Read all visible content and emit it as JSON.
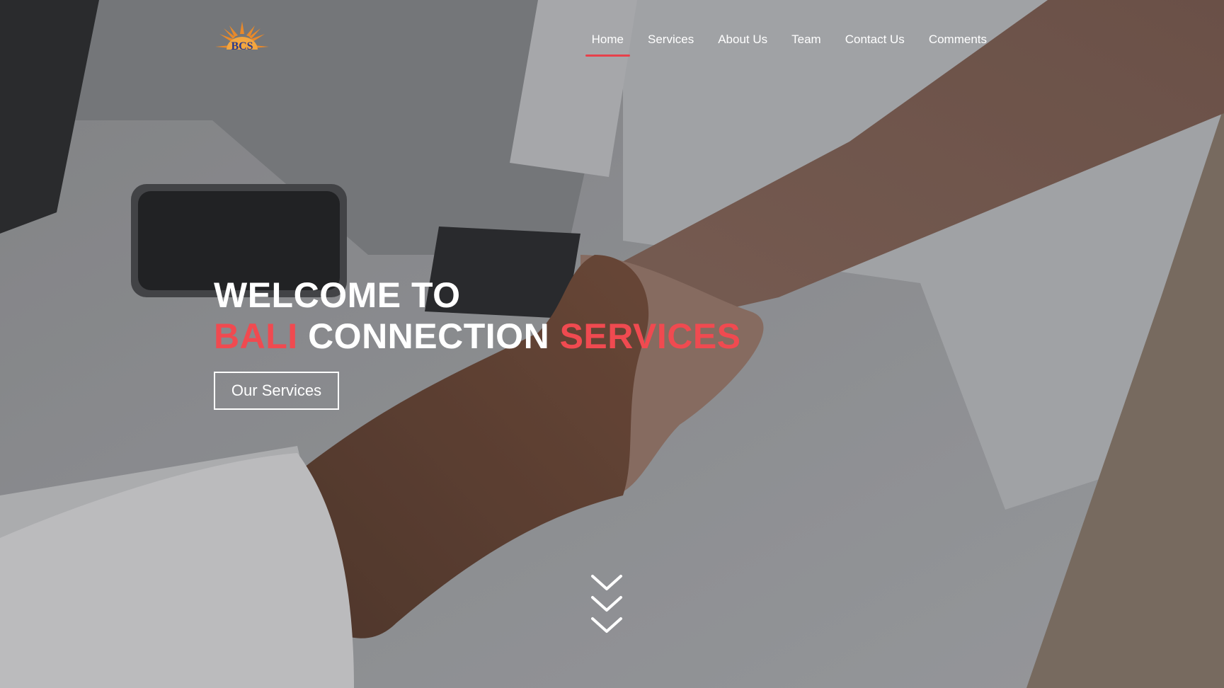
{
  "logo": {
    "text": "BCS"
  },
  "nav": {
    "items": [
      {
        "label": "Home",
        "active": true
      },
      {
        "label": "Services",
        "active": false
      },
      {
        "label": "About Us",
        "active": false
      },
      {
        "label": "Team",
        "active": false
      },
      {
        "label": "Contact Us",
        "active": false
      },
      {
        "label": "Comments",
        "active": false
      }
    ]
  },
  "hero": {
    "line1": "WELCOME TO",
    "line2_part1": "BALI",
    "line2_part2": "CONNECTION",
    "line2_part3": "SERVICES",
    "cta_label": "Our Services"
  },
  "icons": {
    "scroll": "chevrons-down-icon"
  },
  "colors": {
    "accent": "#f04a50",
    "nav_underline": "#e8414b",
    "text": "#ffffff"
  }
}
